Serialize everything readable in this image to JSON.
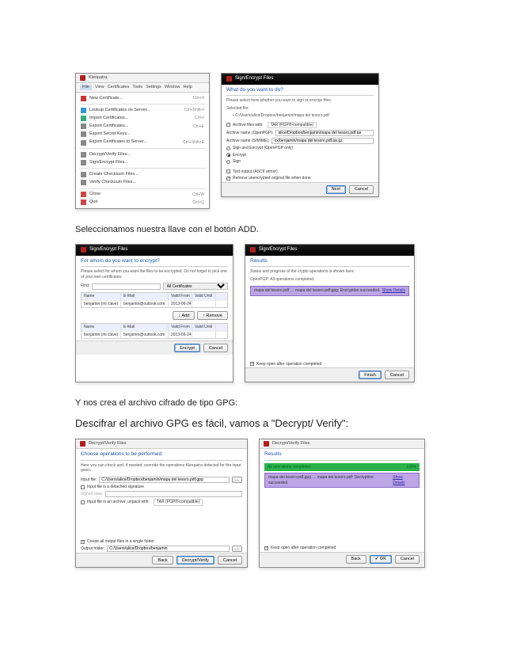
{
  "paragraphs": {
    "p1": "Seleccionamos nuestra llave con el botón ADD.",
    "p2": "Y nos crea el archivo cifrado de tipo GPG:",
    "p3": "Descifrar el archivo GPG es fácil, vamos a \"Decrypt/ Verify\":"
  },
  "menu_window": {
    "title": "Kleopatra",
    "menubar": [
      "File",
      "View",
      "Certificates",
      "Tools",
      "Settings",
      "Window",
      "Help"
    ],
    "items": [
      {
        "icon": "#c33",
        "label": "New Certificate...",
        "shortcut": "Ctrl+N"
      },
      {
        "sep": true
      },
      {
        "icon": "#39c",
        "label": "Lookup Certificates on Server...",
        "shortcut": "Ctrl+Shift+I"
      },
      {
        "icon": "#3a7",
        "label": "Import Certificates...",
        "shortcut": "Ctrl+I"
      },
      {
        "icon": "#888",
        "label": "Export Certificates...",
        "shortcut": "Ctrl+E"
      },
      {
        "icon": "#888",
        "label": "Export Secret Keys...",
        "shortcut": ""
      },
      {
        "icon": "#888",
        "label": "Export Certificates to Server...",
        "shortcut": "Ctrl+Shift+E"
      },
      {
        "sep": true
      },
      {
        "icon": "#888",
        "label": "Decrypt/Verify Files...",
        "shortcut": ""
      },
      {
        "icon": "#888",
        "label": "Sign/Encrypt Files...",
        "shortcut": ""
      },
      {
        "sep": true
      },
      {
        "icon": "#888",
        "label": "Create Checksum Files...",
        "shortcut": ""
      },
      {
        "icon": "#888",
        "label": "Verify Checksum Files...",
        "shortcut": ""
      },
      {
        "sep": true
      },
      {
        "icon": "#c44",
        "label": "Close",
        "shortcut": "Ctrl+W"
      },
      {
        "icon": "#c44",
        "label": "Quit",
        "shortcut": "Ctrl+Q"
      }
    ]
  },
  "wizard1": {
    "title": "Sign/Encrypt Files",
    "heading": "What do you want to do?",
    "subtext": "Please select here whether you want to sign or encrypt files.",
    "selected_label": "Selected file:",
    "selected_file": "C:/Users/alice/Dropbox/benjamin/mapa del tesoro.pdf",
    "archive_with": "Archive files with:",
    "archive_with_value": "TAR (PGP®-compatible)",
    "archive_name_pgp": "Archive name (OpenPGP):",
    "archive_name_pgp_value": "alice/Dropbox/benjamin/mapa del tesoro.pdf.tar",
    "archive_name_smime": "Archive name (S/MIME):",
    "archive_name_smime_value": "ox/benjamin/mapa del tesoro.pdf.tar.gz",
    "opt_sign_encrypt": "Sign and Encrypt (OpenPGP only)",
    "opt_encrypt": "Encrypt",
    "opt_sign": "Sign",
    "opt_text_output": "Text output (ASCII armor)",
    "opt_remove_original": "Remove unencrypted original file when done",
    "btn_next": "Next",
    "btn_cancel": "Cancel"
  },
  "wizard2": {
    "title": "Sign/Encrypt Files",
    "heading": "For whom do you want to encrypt?",
    "subtext": "Please select for whom you want the files to be encrypted. Do not forget to pick one of your own certificates.",
    "find": "Find:",
    "filter": "All Certificates",
    "cols": [
      "Name",
      "E-Mail",
      "Valid From",
      "Valid Until"
    ],
    "row": [
      "benjamin (mi clave)",
      "benjamin@outlook.com",
      "2013-06-24",
      ""
    ],
    "btn_add": "Add",
    "btn_remove": "Remove",
    "btn_encrypt": "Encrypt",
    "btn_cancel": "Cancel"
  },
  "wizard3": {
    "title": "Sign/Encrypt Files",
    "heading": "Results",
    "subtext": "Status and progress of the crypto operations is shown here.",
    "status": "OpenPGP: All operations completed.",
    "result_text": "mapa del tesoro.pdf → mapa del tesoro.pdf.gpg: Encryption succeeded.",
    "result_link": "Show Details",
    "keep_open": "Keep open after operation completed",
    "btn_finish": "Finish",
    "btn_cancel": "Cancel"
  },
  "wizard4": {
    "title": "Decrypt/Verify Files",
    "heading": "Choose operations to be performed",
    "subtext": "Here you can check and, if needed, override the operations Kleopatra detected for the input given.",
    "input_label": "Input file:",
    "input_value": "C:/Users/alice/Dropbox/benjamin/mapa del tesoro.pdf.gpg",
    "detached": "Input file is a detached signature",
    "signed_data": "Signed data:",
    "archive_opt": "Input file is an archive; unpack with:",
    "archive_value": "TAR (PGP®-compatible)",
    "create_folder": "Create all output files in a single folder",
    "output_label": "Output folder:",
    "output_value": "C:/Users/alice/Dropbox/benjamin",
    "btn_back": "Back",
    "btn_decrypt": "Decrypt/Verify",
    "btn_cancel": "Cancel"
  },
  "wizard5": {
    "title": "Decrypt/Verify Files",
    "heading": "Results",
    "done": "All operations completed.",
    "pct": "100%",
    "result_text": "mapa del tesoro.pdf.gpg → mapa del tesoro.pdf: Decryption succeeded.",
    "result_link": "Show Details",
    "keep_open": "Keep open after operation completed",
    "btn_back": "Back",
    "btn_ok": "OK",
    "btn_cancel": "Cancel"
  }
}
